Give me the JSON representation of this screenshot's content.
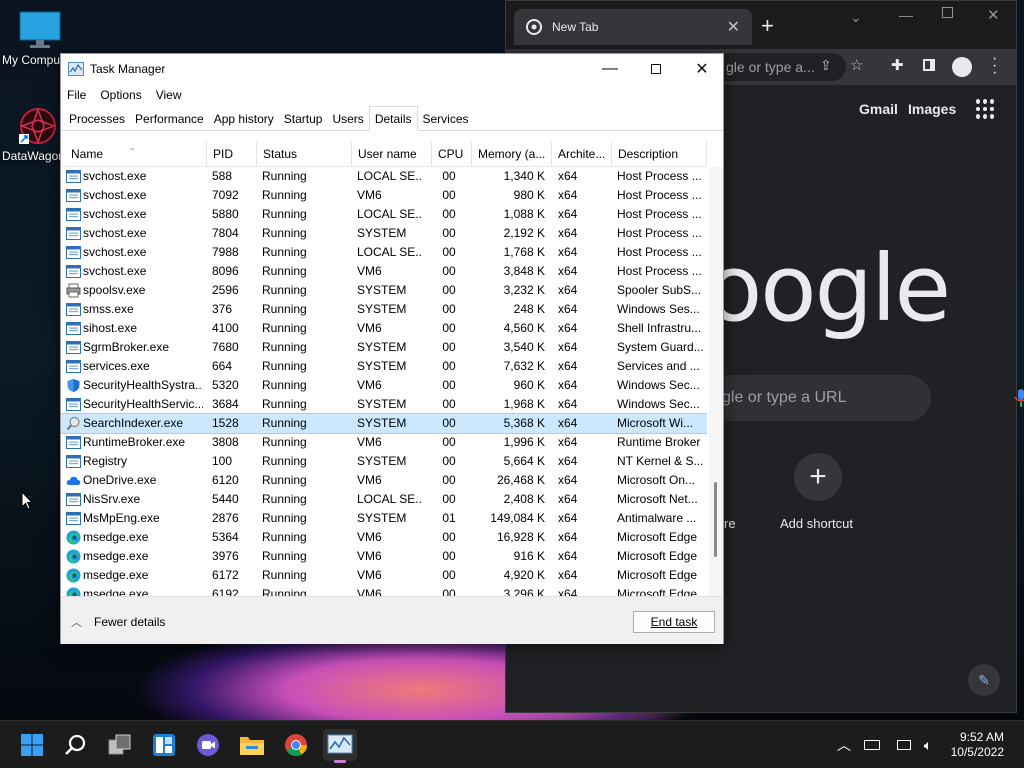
{
  "desktop": {
    "icons": [
      {
        "label": "My Compu"
      },
      {
        "label": "DataWagor"
      }
    ]
  },
  "chrome": {
    "tab_title": "New Tab",
    "omnibox_text": "gle or type a...",
    "links": {
      "gmail": "Gmail",
      "images": "Images"
    },
    "logo_text": "oogle",
    "search_placeholder": "gle or type a URL",
    "shortcut_label": "Add shortcut",
    "partial_shortcut_label": "re"
  },
  "task_manager": {
    "title": "Task Manager",
    "menu": [
      "File",
      "Options",
      "View"
    ],
    "tabs": [
      "Processes",
      "Performance",
      "App history",
      "Startup",
      "Users",
      "Details",
      "Services"
    ],
    "active_tab": "Details",
    "columns": [
      "Name",
      "PID",
      "Status",
      "User name",
      "CPU",
      "Memory (a...",
      "Archite...",
      "Description"
    ],
    "rows": [
      {
        "icon": "service",
        "name": "svchost.exe",
        "pid": "588",
        "status": "Running",
        "user": "LOCAL SE...",
        "cpu": "00",
        "mem": "1,340 K",
        "arch": "x64",
        "desc": "Host Process ..."
      },
      {
        "icon": "service",
        "name": "svchost.exe",
        "pid": "7092",
        "status": "Running",
        "user": "VM6",
        "cpu": "00",
        "mem": "980 K",
        "arch": "x64",
        "desc": "Host Process ..."
      },
      {
        "icon": "service",
        "name": "svchost.exe",
        "pid": "5880",
        "status": "Running",
        "user": "LOCAL SE...",
        "cpu": "00",
        "mem": "1,088 K",
        "arch": "x64",
        "desc": "Host Process ..."
      },
      {
        "icon": "service",
        "name": "svchost.exe",
        "pid": "7804",
        "status": "Running",
        "user": "SYSTEM",
        "cpu": "00",
        "mem": "2,192 K",
        "arch": "x64",
        "desc": "Host Process ..."
      },
      {
        "icon": "service",
        "name": "svchost.exe",
        "pid": "7988",
        "status": "Running",
        "user": "LOCAL SE...",
        "cpu": "00",
        "mem": "1,768 K",
        "arch": "x64",
        "desc": "Host Process ..."
      },
      {
        "icon": "service",
        "name": "svchost.exe",
        "pid": "8096",
        "status": "Running",
        "user": "VM6",
        "cpu": "00",
        "mem": "3,848 K",
        "arch": "x64",
        "desc": "Host Process ..."
      },
      {
        "icon": "printer",
        "name": "spoolsv.exe",
        "pid": "2596",
        "status": "Running",
        "user": "SYSTEM",
        "cpu": "00",
        "mem": "3,232 K",
        "arch": "x64",
        "desc": "Spooler SubS..."
      },
      {
        "icon": "service",
        "name": "smss.exe",
        "pid": "376",
        "status": "Running",
        "user": "SYSTEM",
        "cpu": "00",
        "mem": "248 K",
        "arch": "x64",
        "desc": "Windows Ses..."
      },
      {
        "icon": "service",
        "name": "sihost.exe",
        "pid": "4100",
        "status": "Running",
        "user": "VM6",
        "cpu": "00",
        "mem": "4,560 K",
        "arch": "x64",
        "desc": "Shell Infrastru..."
      },
      {
        "icon": "service",
        "name": "SgrmBroker.exe",
        "pid": "7680",
        "status": "Running",
        "user": "SYSTEM",
        "cpu": "00",
        "mem": "3,540 K",
        "arch": "x64",
        "desc": "System Guard..."
      },
      {
        "icon": "service",
        "name": "services.exe",
        "pid": "664",
        "status": "Running",
        "user": "SYSTEM",
        "cpu": "00",
        "mem": "7,632 K",
        "arch": "x64",
        "desc": "Services and ..."
      },
      {
        "icon": "shield",
        "name": "SecurityHealthSystra...",
        "pid": "5320",
        "status": "Running",
        "user": "VM6",
        "cpu": "00",
        "mem": "960 K",
        "arch": "x64",
        "desc": "Windows Sec..."
      },
      {
        "icon": "service",
        "name": "SecurityHealthServic...",
        "pid": "3684",
        "status": "Running",
        "user": "SYSTEM",
        "cpu": "00",
        "mem": "1,968 K",
        "arch": "x64",
        "desc": "Windows Sec..."
      },
      {
        "icon": "search",
        "name": "SearchIndexer.exe",
        "pid": "1528",
        "status": "Running",
        "user": "SYSTEM",
        "cpu": "00",
        "mem": "5,368 K",
        "arch": "x64",
        "desc": "Microsoft Wi...",
        "selected": true
      },
      {
        "icon": "service",
        "name": "RuntimeBroker.exe",
        "pid": "3808",
        "status": "Running",
        "user": "VM6",
        "cpu": "00",
        "mem": "1,996 K",
        "arch": "x64",
        "desc": "Runtime Broker"
      },
      {
        "icon": "service",
        "name": "Registry",
        "pid": "100",
        "status": "Running",
        "user": "SYSTEM",
        "cpu": "00",
        "mem": "5,664 K",
        "arch": "x64",
        "desc": "NT Kernel & S..."
      },
      {
        "icon": "cloud",
        "name": "OneDrive.exe",
        "pid": "6120",
        "status": "Running",
        "user": "VM6",
        "cpu": "00",
        "mem": "26,468 K",
        "arch": "x64",
        "desc": "Microsoft On..."
      },
      {
        "icon": "service",
        "name": "NisSrv.exe",
        "pid": "5440",
        "status": "Running",
        "user": "LOCAL SE...",
        "cpu": "00",
        "mem": "2,408 K",
        "arch": "x64",
        "desc": "Microsoft Net..."
      },
      {
        "icon": "service",
        "name": "MsMpEng.exe",
        "pid": "2876",
        "status": "Running",
        "user": "SYSTEM",
        "cpu": "01",
        "mem": "149,084 K",
        "arch": "x64",
        "desc": "Antimalware ..."
      },
      {
        "icon": "edge",
        "name": "msedge.exe",
        "pid": "5364",
        "status": "Running",
        "user": "VM6",
        "cpu": "00",
        "mem": "16,928 K",
        "arch": "x64",
        "desc": "Microsoft Edge"
      },
      {
        "icon": "edge",
        "name": "msedge.exe",
        "pid": "3976",
        "status": "Running",
        "user": "VM6",
        "cpu": "00",
        "mem": "916 K",
        "arch": "x64",
        "desc": "Microsoft Edge"
      },
      {
        "icon": "edge",
        "name": "msedge.exe",
        "pid": "6172",
        "status": "Running",
        "user": "VM6",
        "cpu": "00",
        "mem": "4,920 K",
        "arch": "x64",
        "desc": "Microsoft Edge"
      },
      {
        "icon": "edge",
        "name": "msedge.exe",
        "pid": "6192",
        "status": "Running",
        "user": "VM6",
        "cpu": "00",
        "mem": "3,296 K",
        "arch": "x64",
        "desc": "Microsoft Edge"
      }
    ],
    "fewer_details_label": "Fewer details",
    "end_task_label": "End task"
  },
  "taskbar": {
    "clock_time": "9:52 AM",
    "clock_date": "10/5/2022"
  },
  "colors": {
    "selection": "#cce8ff",
    "chrome_bg": "#202124",
    "taskbar_bg": "#1c1c1c",
    "win_blue": "#0078d4"
  }
}
